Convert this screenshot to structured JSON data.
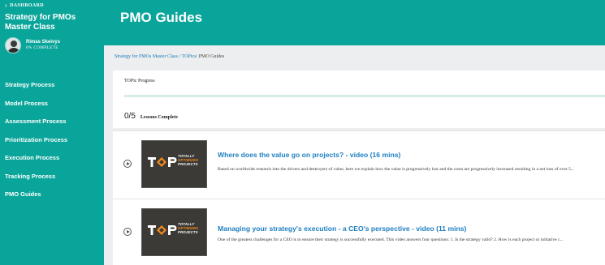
{
  "sidebar": {
    "back_label": "DASHBOARD",
    "course_title": "Strategy for PMOs Master Class",
    "user_name": "Rimas Skeivys",
    "user_progress": "0% COMPLETE",
    "items": [
      {
        "label": "Strategy Process"
      },
      {
        "label": "Model Process"
      },
      {
        "label": "Assessment Process"
      },
      {
        "label": "Prioritization Process"
      },
      {
        "label": "Execution Process"
      },
      {
        "label": "Tracking Process"
      },
      {
        "label": "PMO Guides"
      }
    ]
  },
  "header": {
    "title": "PMO Guides"
  },
  "breadcrumb": {
    "course": "Strategy for PMOs Master Class",
    "sep1": "/",
    "topics": "TOPics",
    "sep2": "/",
    "current": "PMO Guides"
  },
  "progress": {
    "label": "TOPic Progress",
    "fraction": 0,
    "count": "0/5",
    "count_label": "Lessons Complete"
  },
  "thumbnail": {
    "logo_line1": "TOTALLY",
    "logo_line2": "OPTIMIZED",
    "logo_line3": "PROJECTS",
    "logo_letters": "TOP"
  },
  "lessons": [
    {
      "title": "Where does the value go on projects? - video (16 mins)",
      "description": "Based on worldwide research into the drivers and destroyers of value, here we explain how the value is progressively lost and the costs are progressively increased resulting in a net loss of over 5..."
    },
    {
      "title": "Managing your strategy's execution - a CEO's perspective - video (11 mins)",
      "description": "One of the greatest challenges for a CEO is to ensure their strategy is successfully executed. This video answers four questions: 1. Is the strategy valid? 2. How is each project or initiative c..."
    }
  ],
  "colors": {
    "accent": "#0aa59a",
    "link": "#1e7fc0",
    "logo_orange": "#f48a1c"
  }
}
